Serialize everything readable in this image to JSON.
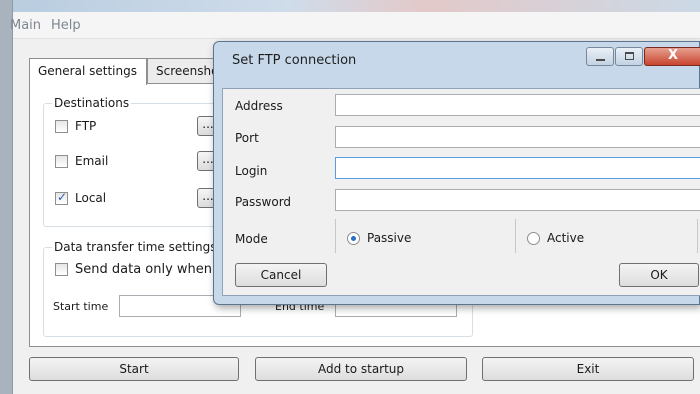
{
  "menu": [
    "Main",
    "Help"
  ],
  "tabs": [
    "General settings",
    "Screenshots"
  ],
  "destinations": {
    "title": "Destinations",
    "items": [
      {
        "label": "FTP",
        "checked": false,
        "button": "..."
      },
      {
        "label": "Email",
        "checked": false,
        "button": "..."
      },
      {
        "label": "Local",
        "checked": true,
        "button": "..."
      }
    ]
  },
  "data_transfer": {
    "title": "Data transfer time settings",
    "checkbox_label": "Send data only when it",
    "start_time_label": "Start time",
    "end_time_label": "End time"
  },
  "bottom_buttons": {
    "start": "Start",
    "add_to_startup": "Add to startup",
    "exit": "Exit"
  },
  "dialog": {
    "title": "Set FTP connection",
    "fields": {
      "address": {
        "label": "Address",
        "value": ""
      },
      "port": {
        "label": "Port",
        "value": ""
      },
      "login": {
        "label": "Login",
        "value": ""
      },
      "password": {
        "label": "Password",
        "value": ""
      }
    },
    "mode": {
      "label": "Mode",
      "passive": "Passive",
      "active": "Active",
      "selected": "Passive"
    },
    "cancel": "Cancel",
    "ok": "OK",
    "close_glyph": "X"
  }
}
